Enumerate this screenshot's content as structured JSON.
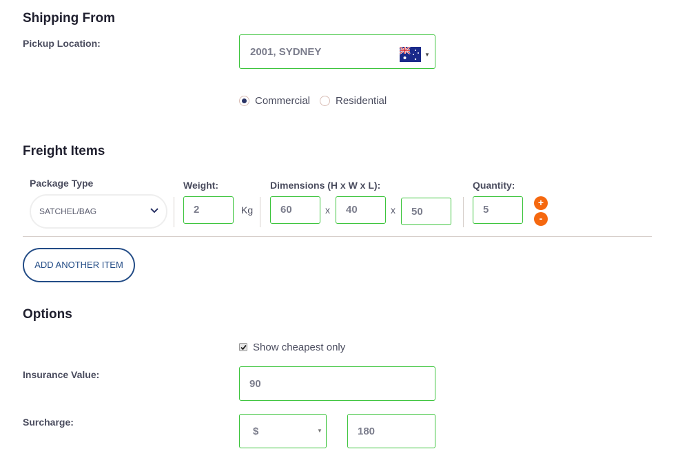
{
  "shipping": {
    "title": "Shipping From",
    "pickup_label": "Pickup Location:",
    "pickup_value": "2001, SYDNEY",
    "country_icon": "flag-australia-icon",
    "dropdown_icon": "caret-down-icon",
    "location_types": [
      {
        "label": "Commercial",
        "selected": true
      },
      {
        "label": "Residential",
        "selected": false
      }
    ]
  },
  "freight": {
    "title": "Freight Items",
    "package_type_label": "Package Type",
    "package_type_value": "SATCHEL/BAG",
    "weight_label": "Weight:",
    "weight_value": "2",
    "weight_unit": "Kg",
    "dimensions_label": "Dimensions (H x W x L):",
    "height_value": "60",
    "width_value": "40",
    "length_value": "50",
    "dim_separator": "x",
    "quantity_label": "Quantity:",
    "quantity_value": "5",
    "increment_label": "+",
    "decrement_label": "-",
    "add_item_label": "ADD ANOTHER ITEM"
  },
  "options": {
    "title": "Options",
    "cheapest_label": "Show cheapest only",
    "cheapest_checked": true,
    "insurance_label": "Insurance Value:",
    "insurance_value": "90",
    "surcharge_label": "Surcharge:",
    "surcharge_type": "$",
    "surcharge_value": "180"
  },
  "colors": {
    "field_border": "#3cc43c",
    "accent_orange": "#f5680f",
    "button_blue": "#234c86",
    "radio_dot": "#2b3466"
  }
}
